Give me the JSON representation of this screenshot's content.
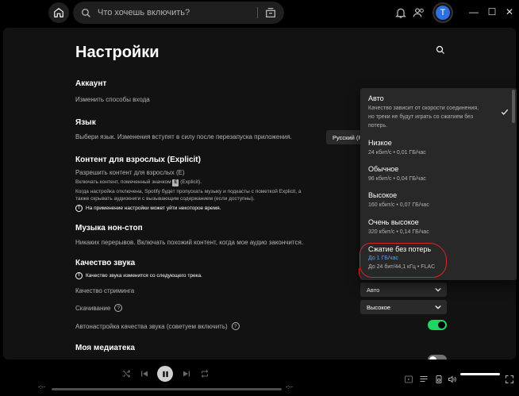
{
  "search": {
    "placeholder": "Что хочешь включить?"
  },
  "user": {
    "avatar_letter": "T"
  },
  "window": {
    "minimize": "—",
    "maximize": "☐",
    "close": "✕"
  },
  "settings": {
    "title": "Настройки",
    "account": {
      "title": "Аккаунт",
      "link": "Изменить способы входа"
    },
    "language": {
      "title": "Язык",
      "desc": "Выбери язык. Изменения вступят в силу после перезапуска приложения.",
      "value": "Русский (R"
    },
    "explicit": {
      "title": "Контент для взрослых (Explicit)",
      "allow": "Разрешить контент для взрослых (Е)",
      "line1a": "Включать контент, помеченный значком",
      "badge": "E",
      "line1b": "(Explicit).",
      "line2": "Когда настройка отключена, Spotify будет пропускать музыку и подкасты с пометкой Explicit, а",
      "line3": "также скрывать аудиокниги с вызывающим содержанием (если доступны).",
      "note": "На применение настройки может уйти некоторое время."
    },
    "autoplay": {
      "title": "Музыка нон-стоп",
      "desc": "Никаких перерывов. Включать похожий контент, когда мое аудио закончится."
    },
    "audio_quality": {
      "title": "Качество звука",
      "note": "Качество звука изменится со следующего трека.",
      "streaming_label": "Качество стриминга",
      "streaming_value": "Авто",
      "download_label": "Скачивание",
      "download_value": "Высокое",
      "auto_adjust_label": "Автонастройка качества звука (советуем включить)",
      "auto_adjust_on": true
    },
    "library": {
      "title": "Моя медиатека"
    }
  },
  "dropdown": {
    "options": [
      {
        "label": "Авто",
        "desc1": "Качество зависит от скорости соединения,",
        "desc2": "но треки не будут играть со сжатием без",
        "desc3": "потерь.",
        "selected": true
      },
      {
        "label": "Низкое",
        "desc1": "24 кбит/с • 0,01 ГБ/час"
      },
      {
        "label": "Обычное",
        "desc1": "96 кбит/с • 0,04 ГБ/час"
      },
      {
        "label": "Высокое",
        "desc1": "160 кбит/с • 0,07 ГБ/час"
      },
      {
        "label": "Очень высокое",
        "desc1": "320 кбит/с • 0,14 ГБ/час"
      },
      {
        "label": "Сжатие без потерь",
        "note": "До 1 ГБ/час",
        "desc1": "До 24 бит/44,1 кГц • FLAC"
      }
    ]
  },
  "player": {
    "elapsed": "-:--",
    "total": "-:--",
    "volume_level": 1.0
  },
  "colors": {
    "accent": "#1ed760",
    "highlight": "#d9252d",
    "link_blue": "#4ea3ff"
  }
}
